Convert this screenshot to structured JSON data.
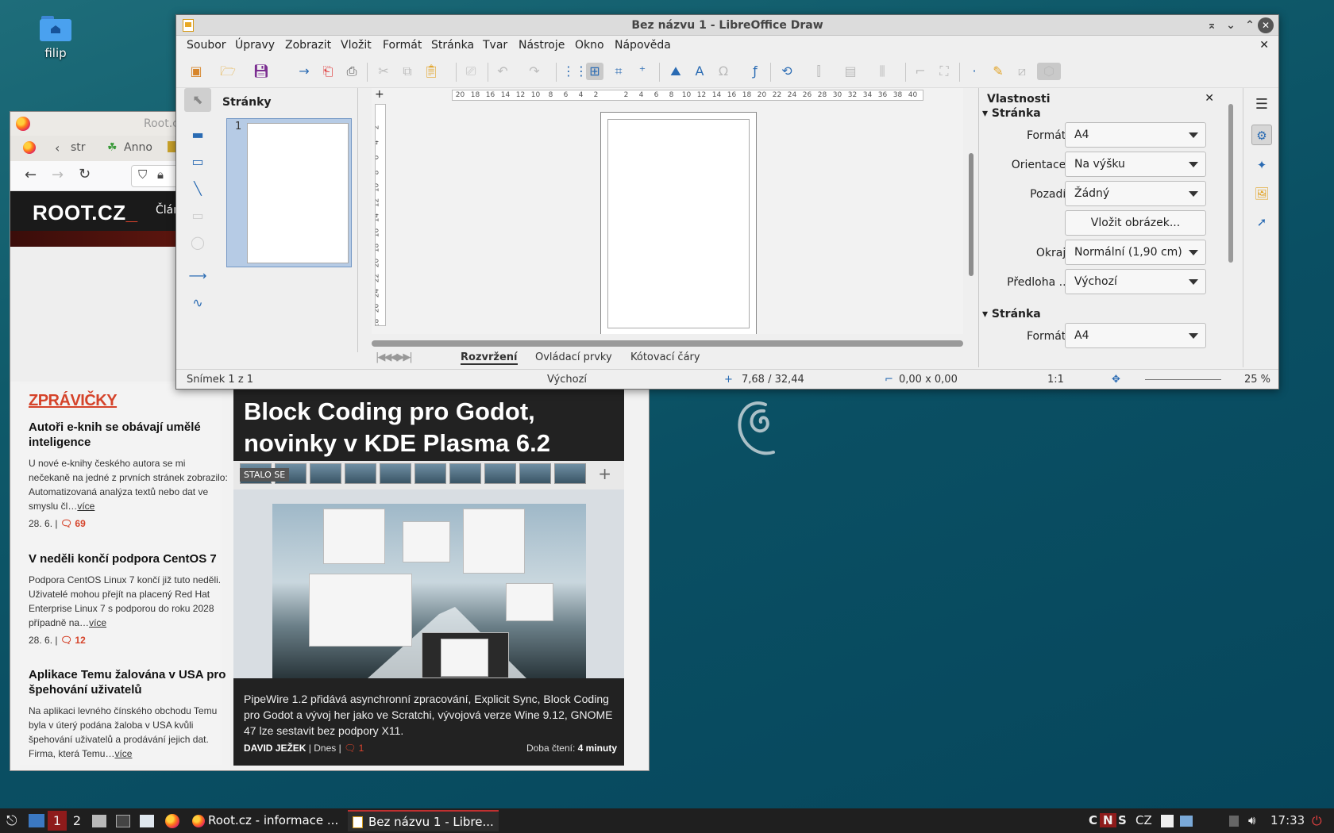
{
  "desktop": {
    "icon_label": "filip"
  },
  "firefox": {
    "title": "Root.c",
    "tabs": [
      "str",
      "Anno"
    ],
    "site": {
      "logo": "ROOT.CZ",
      "logo_underscore": "_",
      "nav_item": "Člán"
    },
    "news_heading": "ZPRÁVIČKY",
    "news": [
      {
        "title": "Autoři e-knih se obávají umělé inteligence",
        "text": "U nové e-knihy českého autora se mi nečekaně na jedné z prvních stránek zobrazilo: Automatizovaná analýza textů nebo dat ve smyslu čl…",
        "more": "více",
        "date": "28. 6.",
        "comments": "69"
      },
      {
        "title": "V neděli končí podpora CentOS 7",
        "text": "Podpora CentOS Linux 7 končí již tuto neděli. Uživatelé mohou přejít na placený Red Hat Enterprise Linux 7 s podporou do roku 2028 případně na…",
        "more": "více",
        "date": "28. 6.",
        "comments": "12"
      },
      {
        "title": "Aplikace Temu žalována v USA pro špehování uživatelů",
        "text": "Na aplikaci levného čínského obchodu Temu byla v úterý podána žaloba v USA kvůli špehování uživatelů a prodávání jejich dat. Firma, která Temu…",
        "more": "více"
      }
    ],
    "feature": {
      "title": "Block Coding pro Godot, novinky v KDE Plasma 6.2",
      "badge": "STALO SE",
      "caption": "PipeWire 1.2 přidává asynchronní zpracování, Explicit Sync, Block Coding pro Godot a vývoj her jako ve Scratchi, vývojová verze Wine 9.12, GNOME 47 lze sestavit bez podpory X11.",
      "author": "DAVID JEŽEK",
      "when": "Dnes",
      "comments": "1",
      "read_label": "Doba čtení:",
      "read_time": "4 minuty"
    }
  },
  "libreoffice": {
    "title": "Bez názvu 1 - LibreOffice Draw",
    "menu": [
      "Soubor",
      "Úpravy",
      "Zobrazit",
      "Vložit",
      "Formát",
      "Stránka",
      "Tvar",
      "Nástroje",
      "Okno",
      "Nápověda"
    ],
    "pages_pane_title": "Stránky",
    "page_number": "1",
    "ruler_h": [
      "20",
      "18",
      "16",
      "14",
      "12",
      "10",
      "8",
      "6",
      "4",
      "2",
      "",
      "2",
      "4",
      "6",
      "8",
      "10",
      "12",
      "14",
      "16",
      "18",
      "20",
      "22",
      "24",
      "26",
      "28",
      "30",
      "32",
      "34",
      "36",
      "38",
      "40"
    ],
    "ruler_v": [
      "",
      "2",
      "4",
      "6",
      "8",
      "10",
      "12",
      "14",
      "16",
      "18",
      "20",
      "22",
      "24",
      "26",
      "28"
    ],
    "layer_tabs": [
      "Rozvržení",
      "Ovládací prvky",
      "Kótovací čáry"
    ],
    "status": {
      "slide": "Snímek 1 z 1",
      "layout": "Výchozí",
      "position": "7,68 / 32,44",
      "size": "0,00 x 0,00",
      "scale": "1:1",
      "zoom": "25 %"
    },
    "properties": {
      "title": "Vlastnosti",
      "section": "Stránka",
      "rows": [
        {
          "label": "Formát:",
          "value": "A4"
        },
        {
          "label": "Orientace:",
          "value": "Na výšku"
        },
        {
          "label": "Pozadí:",
          "value": "Žádný"
        },
        {
          "label": "",
          "value": "Vložit obrázek..."
        },
        {
          "label": "Okraj:",
          "value": "Normální (1,90 cm)"
        },
        {
          "label": "Předloha ...",
          "value": "Výchozí"
        }
      ],
      "section2": "Stránka",
      "row2": {
        "label": "Formát:",
        "value": "A4"
      }
    }
  },
  "taskbar": {
    "workspaces": [
      "1",
      "2"
    ],
    "tasks": [
      "Root.cz - informace ...",
      "Bez názvu 1 - Libre..."
    ],
    "indicators": [
      "C",
      "N",
      "S"
    ],
    "keyboard": "CZ",
    "clock": "17:33"
  }
}
